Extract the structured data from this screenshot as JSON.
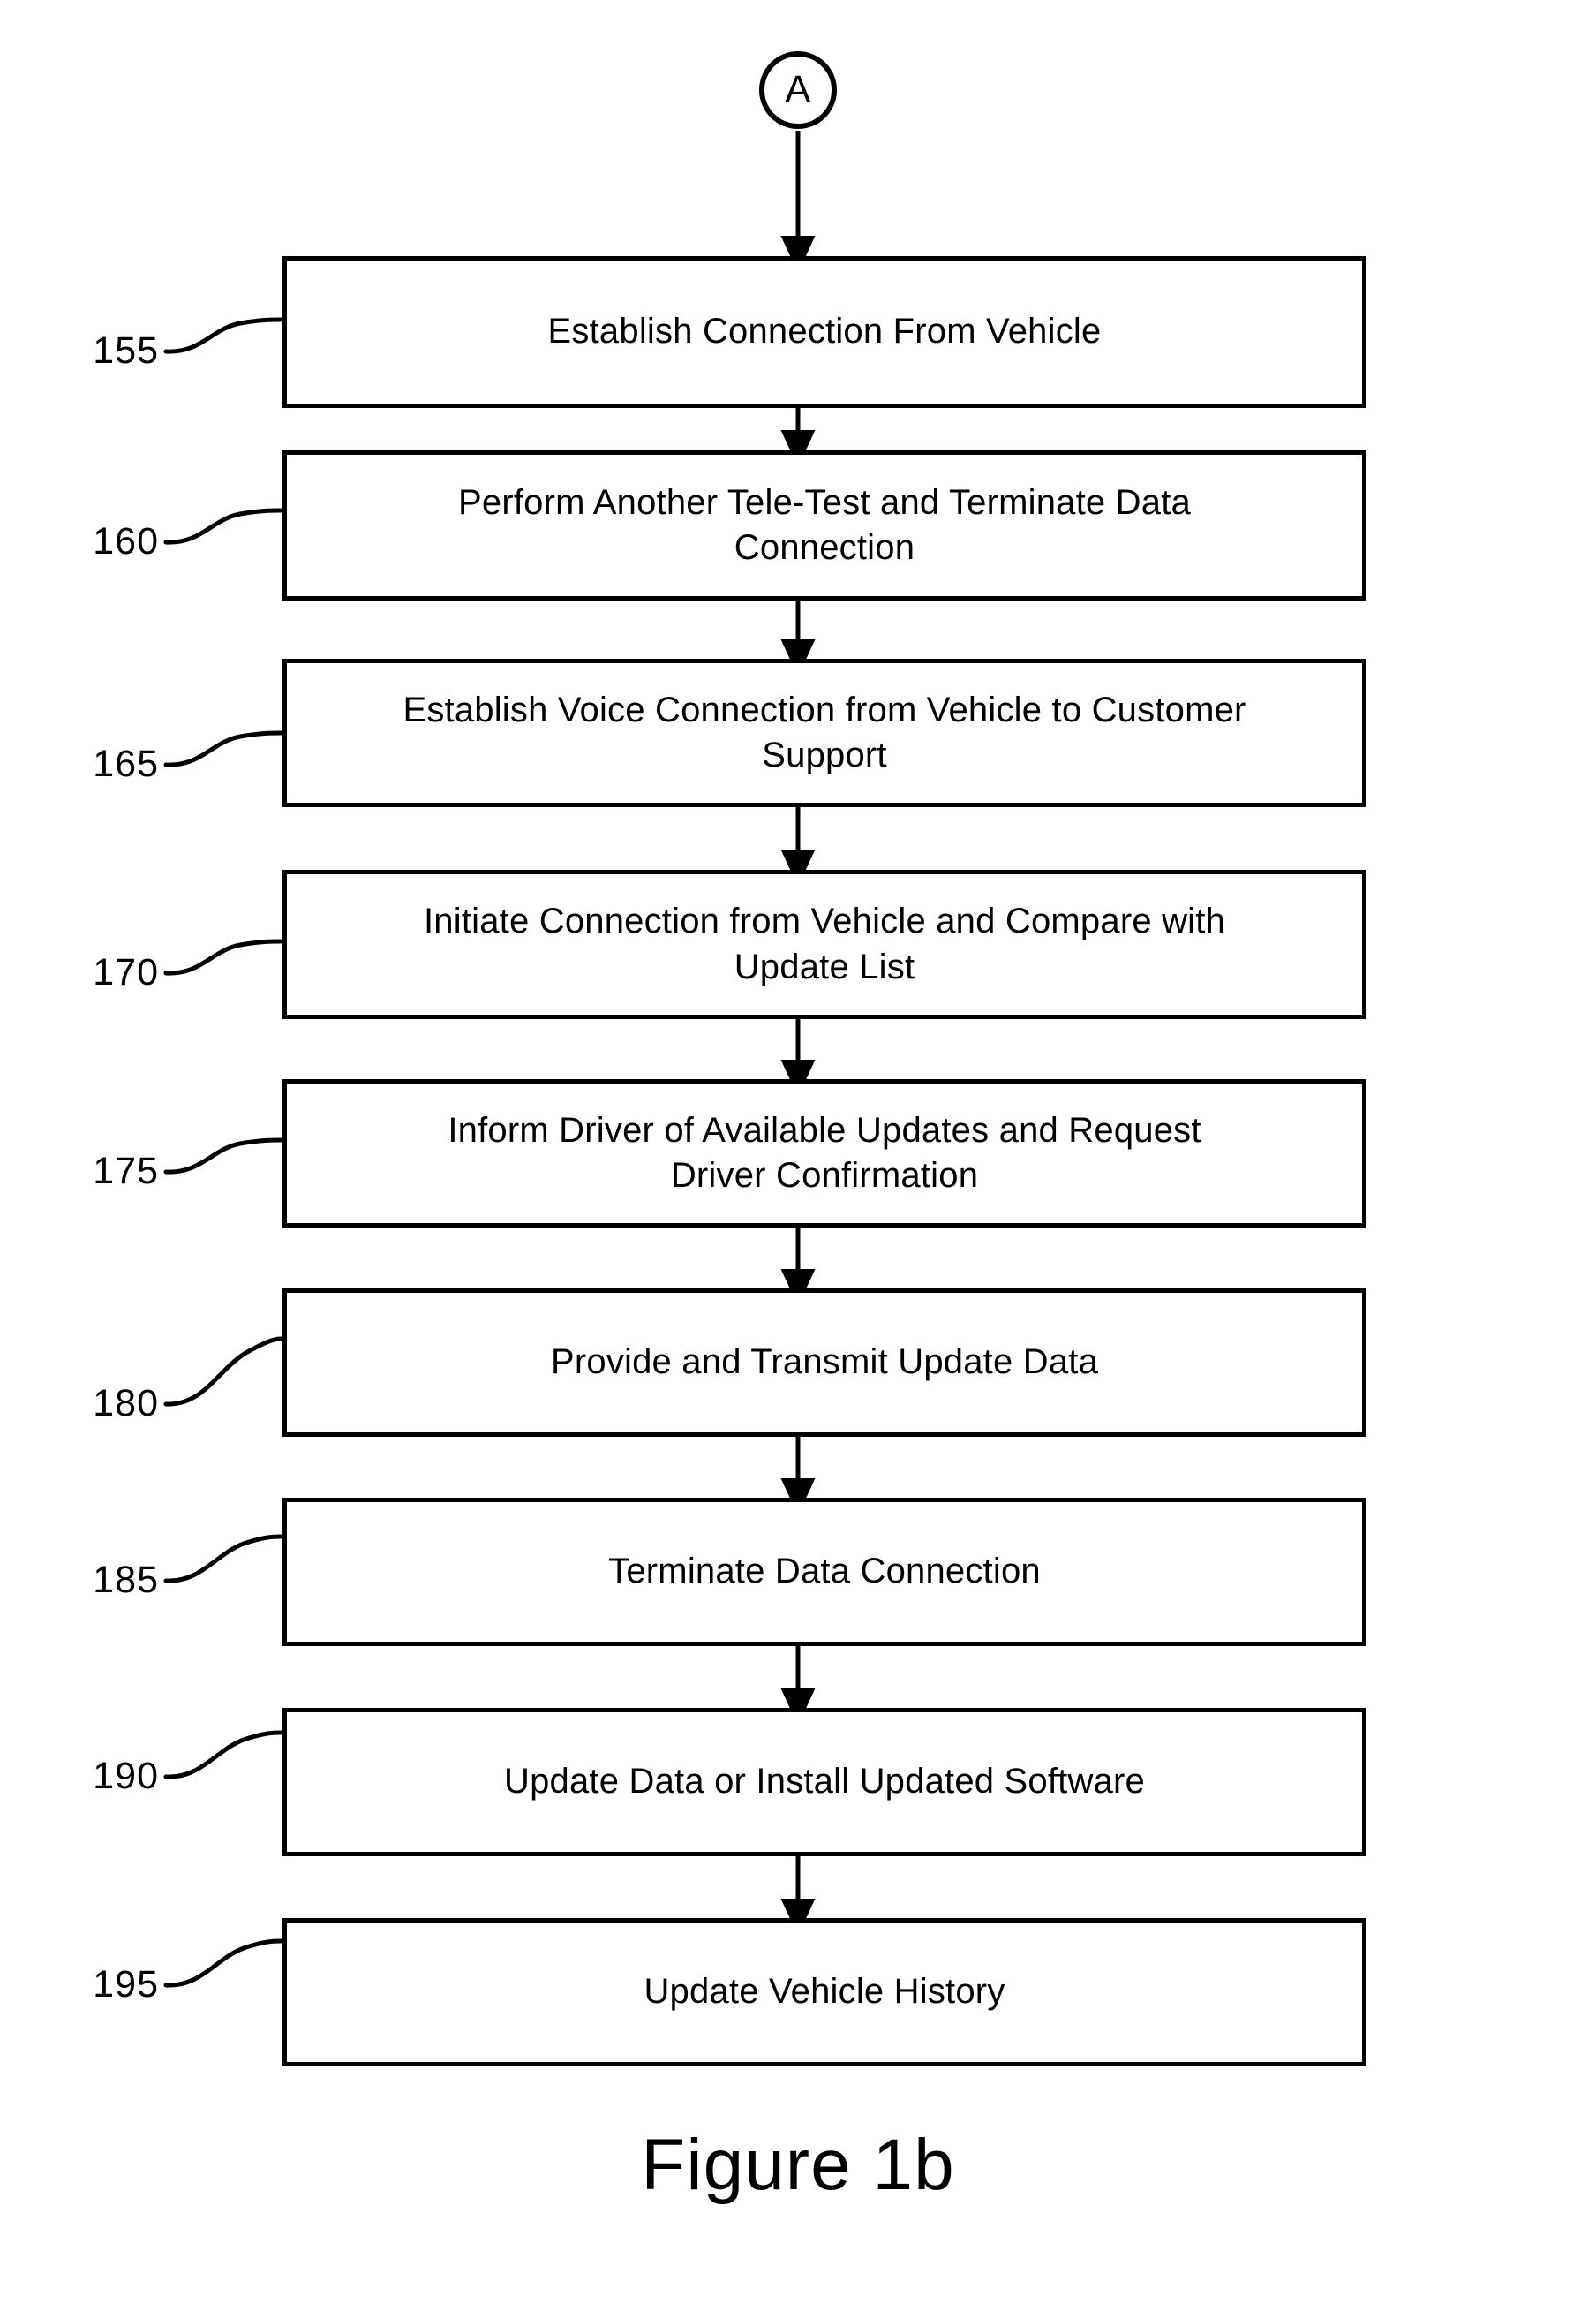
{
  "figure": {
    "caption": "Figure 1b",
    "connector": {
      "label": "A",
      "name": "connector-a"
    }
  },
  "steps": [
    {
      "ref": "155",
      "text": "Establish Connection From Vehicle"
    },
    {
      "ref": "160",
      "text": "Perform Another Tele-Test and Terminate Data\nConnection"
    },
    {
      "ref": "165",
      "text": "Establish Voice Connection from Vehicle to Customer\nSupport"
    },
    {
      "ref": "170",
      "text": "Initiate Connection from Vehicle and Compare with\nUpdate List"
    },
    {
      "ref": "175",
      "text": "Inform Driver of Available Updates and Request\nDriver Confirmation"
    },
    {
      "ref": "180",
      "text": "Provide and Transmit Update Data"
    },
    {
      "ref": "185",
      "text": "Terminate Data Connection"
    },
    {
      "ref": "190",
      "text": "Update Data or Install Updated Software"
    },
    {
      "ref": "195",
      "text": "Update Vehicle History"
    }
  ],
  "colors": {
    "ink": "#000000",
    "paper": "#ffffff"
  }
}
